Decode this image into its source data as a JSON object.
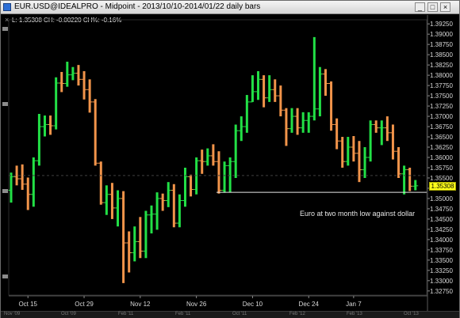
{
  "window": {
    "title": "EUR.USD@IDEALPRO - Midpoint - 2013/10/10-2014/01/22 daily bars",
    "buttons": {
      "minimize": "_",
      "maximize": "□",
      "close": "×"
    }
  },
  "info_line": "L: 1.35308 CH: -0.00220 CH%: -0.16%",
  "annotation": "Euro at two month low against dollar",
  "last_price_label": "1.35308",
  "timebar_labels": [
    "Nov '09",
    "Oct '09",
    "Feb '11",
    "Feb '11",
    "Oct '11",
    "Feb '12",
    "Feb '13",
    "Oct '13"
  ],
  "colors": {
    "up": "#22e046",
    "down": "#f2944a",
    "support_line": "#e8e8e8",
    "price_tag": "#ffff1a"
  },
  "chart_data": {
    "type": "ohlc",
    "title": "EUR.USD@IDEALPRO - Midpoint - 2013/10/10-2014/01/22 daily bars",
    "xlabel": "",
    "ylabel": "",
    "x_tick_labels": [
      "Oct 15",
      "Oct 29",
      "Nov 12",
      "Nov 26",
      "Dec 10",
      "Dec 24",
      "Jan 7"
    ],
    "y_tick_labels": [
      "1.32750",
      "1.33000",
      "1.33250",
      "1.33500",
      "1.33750",
      "1.34000",
      "1.34250",
      "1.34500",
      "1.34750",
      "1.35000",
      "1.35250",
      "1.35500",
      "1.35750",
      "1.36000",
      "1.36250",
      "1.36500",
      "1.36750",
      "1.37000",
      "1.37250",
      "1.37500",
      "1.37750",
      "1.38000",
      "1.38250",
      "1.38500",
      "1.38750",
      "1.39000",
      "1.39250"
    ],
    "ylim": [
      1.3265,
      1.3935
    ],
    "support_level": 1.3515,
    "reference_level": 1.3556,
    "series": [
      {
        "bars": [
          {
            "date": "2013-10-10",
            "open": 1.352,
            "high": 1.3563,
            "low": 1.349,
            "close": 1.3553
          },
          {
            "date": "2013-10-11",
            "open": 1.3553,
            "high": 1.358,
            "low": 1.3532,
            "close": 1.3548
          },
          {
            "date": "2013-10-14",
            "open": 1.3548,
            "high": 1.3583,
            "low": 1.3521,
            "close": 1.3535
          },
          {
            "date": "2013-10-15",
            "open": 1.3535,
            "high": 1.3551,
            "low": 1.3472,
            "close": 1.351
          },
          {
            "date": "2013-10-16",
            "open": 1.351,
            "high": 1.36,
            "low": 1.348,
            "close": 1.3592
          },
          {
            "date": "2013-10-17",
            "open": 1.3592,
            "high": 1.3706,
            "low": 1.358,
            "close": 1.3675
          },
          {
            "date": "2013-10-18",
            "open": 1.3675,
            "high": 1.3702,
            "low": 1.3651,
            "close": 1.368
          },
          {
            "date": "2013-10-21",
            "open": 1.368,
            "high": 1.3702,
            "low": 1.3655,
            "close": 1.3677
          },
          {
            "date": "2013-10-22",
            "open": 1.3677,
            "high": 1.3795,
            "low": 1.3668,
            "close": 1.3781
          },
          {
            "date": "2013-10-23",
            "open": 1.3781,
            "high": 1.3808,
            "low": 1.3759,
            "close": 1.378
          },
          {
            "date": "2013-10-24",
            "open": 1.378,
            "high": 1.3833,
            "low": 1.3772,
            "close": 1.3801
          },
          {
            "date": "2013-10-25",
            "open": 1.3801,
            "high": 1.382,
            "low": 1.3788,
            "close": 1.3805
          },
          {
            "date": "2013-10-28",
            "open": 1.3805,
            "high": 1.3825,
            "low": 1.3775,
            "close": 1.379
          },
          {
            "date": "2013-10-29",
            "open": 1.379,
            "high": 1.381,
            "low": 1.3741,
            "close": 1.3765
          },
          {
            "date": "2013-10-30",
            "open": 1.3765,
            "high": 1.379,
            "low": 1.3709,
            "close": 1.3735
          },
          {
            "date": "2013-10-31",
            "open": 1.3735,
            "high": 1.3742,
            "low": 1.358,
            "close": 1.3586
          },
          {
            "date": "2013-11-01",
            "open": 1.3586,
            "high": 1.359,
            "low": 1.3485,
            "close": 1.349
          },
          {
            "date": "2013-11-04",
            "open": 1.349,
            "high": 1.3532,
            "low": 1.346,
            "close": 1.351
          },
          {
            "date": "2013-11-05",
            "open": 1.351,
            "high": 1.3538,
            "low": 1.345,
            "close": 1.3477
          },
          {
            "date": "2013-11-06",
            "open": 1.3477,
            "high": 1.352,
            "low": 1.3432,
            "close": 1.35
          },
          {
            "date": "2013-11-07",
            "open": 1.35,
            "high": 1.3518,
            "low": 1.3294,
            "close": 1.3392
          },
          {
            "date": "2013-11-08",
            "open": 1.3392,
            "high": 1.342,
            "low": 1.332,
            "close": 1.3368
          },
          {
            "date": "2013-11-11",
            "open": 1.3368,
            "high": 1.3432,
            "low": 1.3347,
            "close": 1.3395
          },
          {
            "date": "2013-11-12",
            "open": 1.3395,
            "high": 1.3455,
            "low": 1.3355,
            "close": 1.3372
          },
          {
            "date": "2013-11-13",
            "open": 1.3372,
            "high": 1.347,
            "low": 1.3355,
            "close": 1.346
          },
          {
            "date": "2013-11-14",
            "open": 1.346,
            "high": 1.3483,
            "low": 1.3415,
            "close": 1.3462
          },
          {
            "date": "2013-11-15",
            "open": 1.3462,
            "high": 1.3515,
            "low": 1.3424,
            "close": 1.35
          },
          {
            "date": "2013-11-18",
            "open": 1.35,
            "high": 1.3512,
            "low": 1.347,
            "close": 1.3495
          },
          {
            "date": "2013-11-19",
            "open": 1.3495,
            "high": 1.354,
            "low": 1.3479,
            "close": 1.352
          },
          {
            "date": "2013-11-20",
            "open": 1.352,
            "high": 1.3535,
            "low": 1.343,
            "close": 1.344
          },
          {
            "date": "2013-11-21",
            "open": 1.344,
            "high": 1.351,
            "low": 1.343,
            "close": 1.3495
          },
          {
            "date": "2013-11-22",
            "open": 1.3495,
            "high": 1.3575,
            "low": 1.348,
            "close": 1.3553
          },
          {
            "date": "2013-11-25",
            "open": 1.3553,
            "high": 1.3558,
            "low": 1.3505,
            "close": 1.3522
          },
          {
            "date": "2013-11-26",
            "open": 1.3522,
            "high": 1.36,
            "low": 1.351,
            "close": 1.3592
          },
          {
            "date": "2013-11-27",
            "open": 1.3592,
            "high": 1.3619,
            "low": 1.356,
            "close": 1.359
          },
          {
            "date": "2013-11-28",
            "open": 1.359,
            "high": 1.3622,
            "low": 1.358,
            "close": 1.3604
          },
          {
            "date": "2013-11-29",
            "open": 1.3604,
            "high": 1.3632,
            "low": 1.358,
            "close": 1.359
          },
          {
            "date": "2013-12-02",
            "open": 1.359,
            "high": 1.3615,
            "low": 1.3512,
            "close": 1.352
          },
          {
            "date": "2013-12-03",
            "open": 1.352,
            "high": 1.359,
            "low": 1.3514,
            "close": 1.358
          },
          {
            "date": "2013-12-04",
            "open": 1.358,
            "high": 1.36,
            "low": 1.3515,
            "close": 1.359
          },
          {
            "date": "2013-12-05",
            "open": 1.359,
            "high": 1.368,
            "low": 1.355,
            "close": 1.3665
          },
          {
            "date": "2013-12-06",
            "open": 1.3665,
            "high": 1.37,
            "low": 1.364,
            "close": 1.3675
          },
          {
            "date": "2013-12-09",
            "open": 1.3675,
            "high": 1.3752,
            "low": 1.366,
            "close": 1.3735
          },
          {
            "date": "2013-12-10",
            "open": 1.3735,
            "high": 1.38,
            "low": 1.3735,
            "close": 1.376
          },
          {
            "date": "2013-12-11",
            "open": 1.376,
            "high": 1.381,
            "low": 1.374,
            "close": 1.379
          },
          {
            "date": "2013-12-12",
            "open": 1.379,
            "high": 1.38,
            "low": 1.3722,
            "close": 1.3745
          },
          {
            "date": "2013-12-13",
            "open": 1.3745,
            "high": 1.38,
            "low": 1.3735,
            "close": 1.3765
          },
          {
            "date": "2013-12-16",
            "open": 1.3765,
            "high": 1.379,
            "low": 1.3735,
            "close": 1.375
          },
          {
            "date": "2013-12-17",
            "open": 1.375,
            "high": 1.3775,
            "low": 1.37,
            "close": 1.3715
          },
          {
            "date": "2013-12-18",
            "open": 1.3715,
            "high": 1.372,
            "low": 1.3628,
            "close": 1.367
          },
          {
            "date": "2013-12-19",
            "open": 1.367,
            "high": 1.372,
            "low": 1.366,
            "close": 1.37
          },
          {
            "date": "2013-12-20",
            "open": 1.37,
            "high": 1.372,
            "low": 1.3655,
            "close": 1.3672
          },
          {
            "date": "2013-12-23",
            "open": 1.3672,
            "high": 1.371,
            "low": 1.366,
            "close": 1.369
          },
          {
            "date": "2013-12-24",
            "open": 1.369,
            "high": 1.371,
            "low": 1.366,
            "close": 1.37
          },
          {
            "date": "2013-12-26",
            "open": 1.37,
            "high": 1.3893,
            "low": 1.369,
            "close": 1.3718
          },
          {
            "date": "2013-12-27",
            "open": 1.3718,
            "high": 1.382,
            "low": 1.37,
            "close": 1.3803
          },
          {
            "date": "2013-12-30",
            "open": 1.3803,
            "high": 1.3815,
            "low": 1.375,
            "close": 1.378
          },
          {
            "date": "2013-12-31",
            "open": 1.378,
            "high": 1.3785,
            "low": 1.3665,
            "close": 1.368
          },
          {
            "date": "2014-01-02",
            "open": 1.368,
            "high": 1.3695,
            "low": 1.362,
            "close": 1.364
          },
          {
            "date": "2014-01-03",
            "open": 1.364,
            "high": 1.365,
            "low": 1.3575,
            "close": 1.359
          },
          {
            "date": "2014-01-06",
            "open": 1.359,
            "high": 1.365,
            "low": 1.358,
            "close": 1.3625
          },
          {
            "date": "2014-01-07",
            "open": 1.3625,
            "high": 1.3652,
            "low": 1.359,
            "close": 1.361
          },
          {
            "date": "2014-01-08",
            "open": 1.361,
            "high": 1.364,
            "low": 1.354,
            "close": 1.357
          },
          {
            "date": "2014-01-09",
            "open": 1.357,
            "high": 1.3625,
            "low": 1.355,
            "close": 1.36
          },
          {
            "date": "2014-01-10",
            "open": 1.36,
            "high": 1.369,
            "low": 1.359,
            "close": 1.368
          },
          {
            "date": "2014-01-13",
            "open": 1.368,
            "high": 1.369,
            "low": 1.366,
            "close": 1.3672
          },
          {
            "date": "2014-01-14",
            "open": 1.3672,
            "high": 1.369,
            "low": 1.363,
            "close": 1.3672
          },
          {
            "date": "2014-01-15",
            "open": 1.3672,
            "high": 1.37,
            "low": 1.364,
            "close": 1.366
          },
          {
            "date": "2014-01-16",
            "open": 1.366,
            "high": 1.368,
            "low": 1.3595,
            "close": 1.3615
          },
          {
            "date": "2014-01-17",
            "open": 1.3615,
            "high": 1.3625,
            "low": 1.355,
            "close": 1.356
          },
          {
            "date": "2014-01-20",
            "open": 1.356,
            "high": 1.358,
            "low": 1.351,
            "close": 1.357
          },
          {
            "date": "2014-01-21",
            "open": 1.357,
            "high": 1.3575,
            "low": 1.3518,
            "close": 1.353
          },
          {
            "date": "2014-01-22",
            "open": 1.353,
            "high": 1.3545,
            "low": 1.352,
            "close": 1.3531
          }
        ]
      }
    ]
  }
}
